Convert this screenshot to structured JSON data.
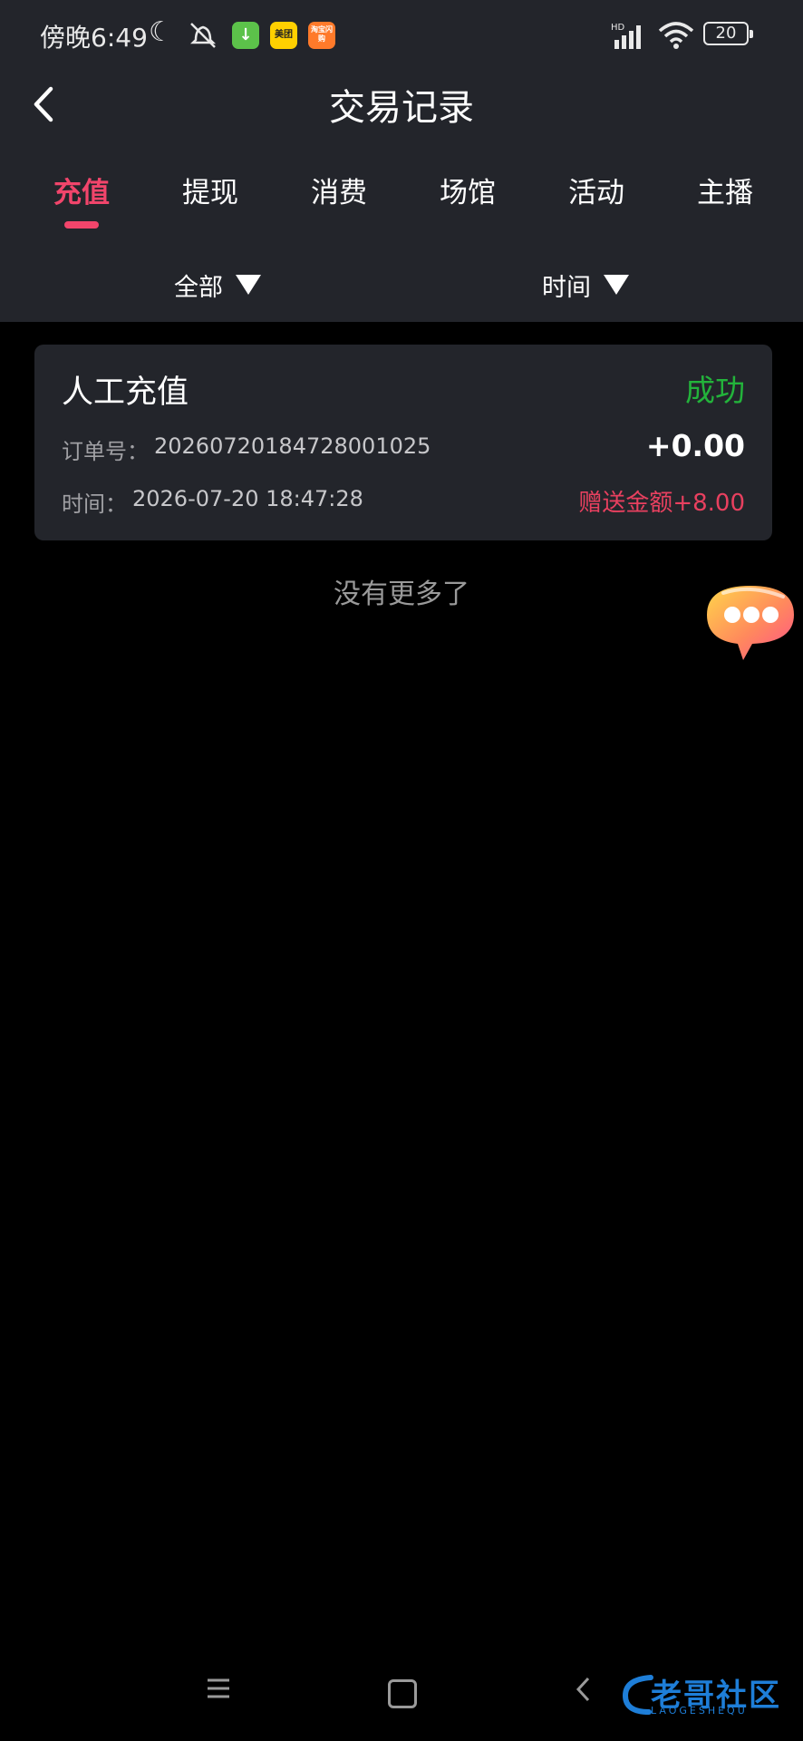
{
  "status_bar": {
    "time": "傍晚6:49",
    "moon_icon": "moon-icon",
    "mute_icon": "bell-off-icon",
    "apps": [
      "download",
      "美团",
      "淘宝闪购"
    ],
    "signal": "HD",
    "battery": "20"
  },
  "header": {
    "title": "交易记录",
    "back_icon": "chevron-left-icon"
  },
  "tabs": [
    {
      "label": "充值",
      "active": true
    },
    {
      "label": "提现",
      "active": false
    },
    {
      "label": "消费",
      "active": false
    },
    {
      "label": "场馆",
      "active": false
    },
    {
      "label": "活动",
      "active": false
    },
    {
      "label": "主播",
      "active": false
    }
  ],
  "filters": {
    "type": "全部",
    "time": "时间"
  },
  "records": [
    {
      "type": "人工充值",
      "status": "成功",
      "order_label": "订单号：",
      "order_no": "20260720184728001025",
      "amount": "+0.00",
      "time_label": "时间：",
      "time": "2026-07-20 18:47:28",
      "gift": "赠送金额+8.00"
    }
  ],
  "footer_text": "没有更多了",
  "watermark": {
    "text": "老哥社区",
    "sub": "LAOGESHEQU"
  },
  "colors": {
    "accent": "#f1456b",
    "success": "#23b33b",
    "gift": "#e8405f",
    "panel": "#23252b",
    "background": "#000000"
  }
}
